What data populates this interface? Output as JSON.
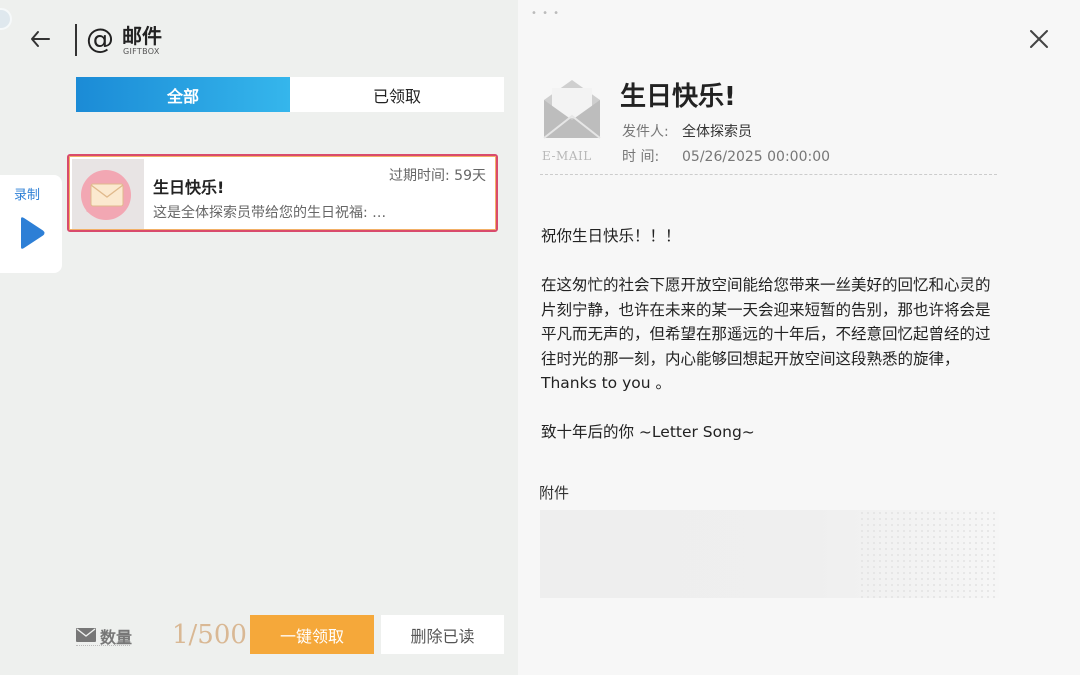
{
  "header": {
    "title": "邮件",
    "subtitle": "GIFTBOX"
  },
  "tabs": [
    {
      "label": "全部",
      "active": true
    },
    {
      "label": "已领取",
      "active": false
    }
  ],
  "record": {
    "label": "录制"
  },
  "mail_list": [
    {
      "title": "生日快乐!",
      "expire": "过期时间: 59天",
      "preview": "这是全体探索员带给您的生日祝福: …",
      "selected": true
    }
  ],
  "footer": {
    "count_label": "数量",
    "count": "1/500",
    "claim_all": "一键领取",
    "delete_read": "删除已读"
  },
  "detail": {
    "email_tag": "E-MAIL",
    "title": "生日快乐!",
    "sender_label": "发件人:",
    "sender": "全体探索员",
    "time_label": "时 间:",
    "time": "05/26/2025 00:00:00",
    "paragraphs": [
      "祝你生日快乐！！！",
      "在这匆忙的社会下愿开放空间能给您带来一丝美好的回忆和心灵的片刻宁静，也许在未来的某一天会迎来短暂的告别，那也许将会是平凡而无声的，但希望在那遥远的十年后，不经意回忆起曾经的过往时光的那一刻，内心能够回想起开放空间这段熟悉的旋律，Thanks to you 。",
      "致十年后的你 ~Letter Song~"
    ],
    "attachments_label": "附件"
  },
  "colors": {
    "tab_active_start": "#1b8bd6",
    "tab_active_end": "#35b6ec",
    "claim_button": "#f5a83a",
    "selected_border": "#d94b6c",
    "record_blue": "#2d7fd6"
  }
}
